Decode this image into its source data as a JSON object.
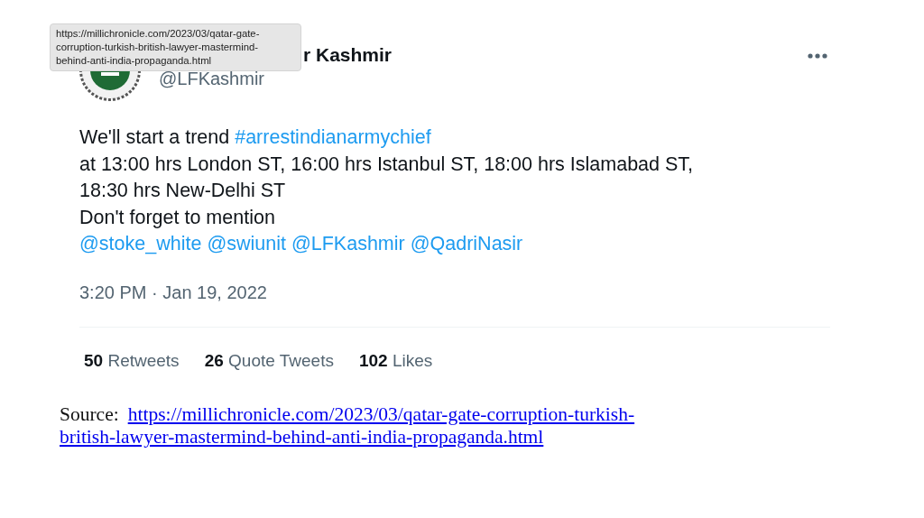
{
  "tooltip": {
    "lines": [
      "https://millichronicle.com/2023/03/qatar-gate-",
      "corruption-turkish-british-lawyer-mastermind-",
      "behind-anti-india-propaganda.html"
    ]
  },
  "tweet": {
    "name": "r Kashmir",
    "handle": "@LFKashmir",
    "body": [
      [
        {
          "kind": "plain",
          "text": "We'll start a trend "
        },
        {
          "kind": "link",
          "text": "#arrestindianarmychief"
        }
      ],
      [
        {
          "kind": "plain",
          "text": "at 13:00 hrs London ST, 16:00 hrs Istanbul ST, 18:00 hrs Islamabad ST,"
        }
      ],
      [
        {
          "kind": "plain",
          "text": "18:30 hrs New-Delhi ST"
        }
      ],
      [
        {
          "kind": "plain",
          "text": "Don't forget to mention"
        }
      ],
      [
        {
          "kind": "link",
          "text": "@stoke_white"
        },
        {
          "kind": "link",
          "text": "@swiunit"
        },
        {
          "kind": "link",
          "text": "@LFKashmir"
        },
        {
          "kind": "link",
          "text": "@QadriNasir"
        }
      ]
    ],
    "timestamp": "3:20 PM · Jan 19, 2022",
    "stats": [
      {
        "count": "50",
        "label": "Retweets"
      },
      {
        "count": "26",
        "label": "Quote Tweets"
      },
      {
        "count": "102",
        "label": "Likes"
      }
    ]
  },
  "source": {
    "label": "Source:",
    "url_lines": [
      "https://millichronicle.com/2023/03/qatar-gate-corruption-turkish-",
      "british-lawyer-mastermind-behind-anti-india-propaganda.html"
    ]
  }
}
